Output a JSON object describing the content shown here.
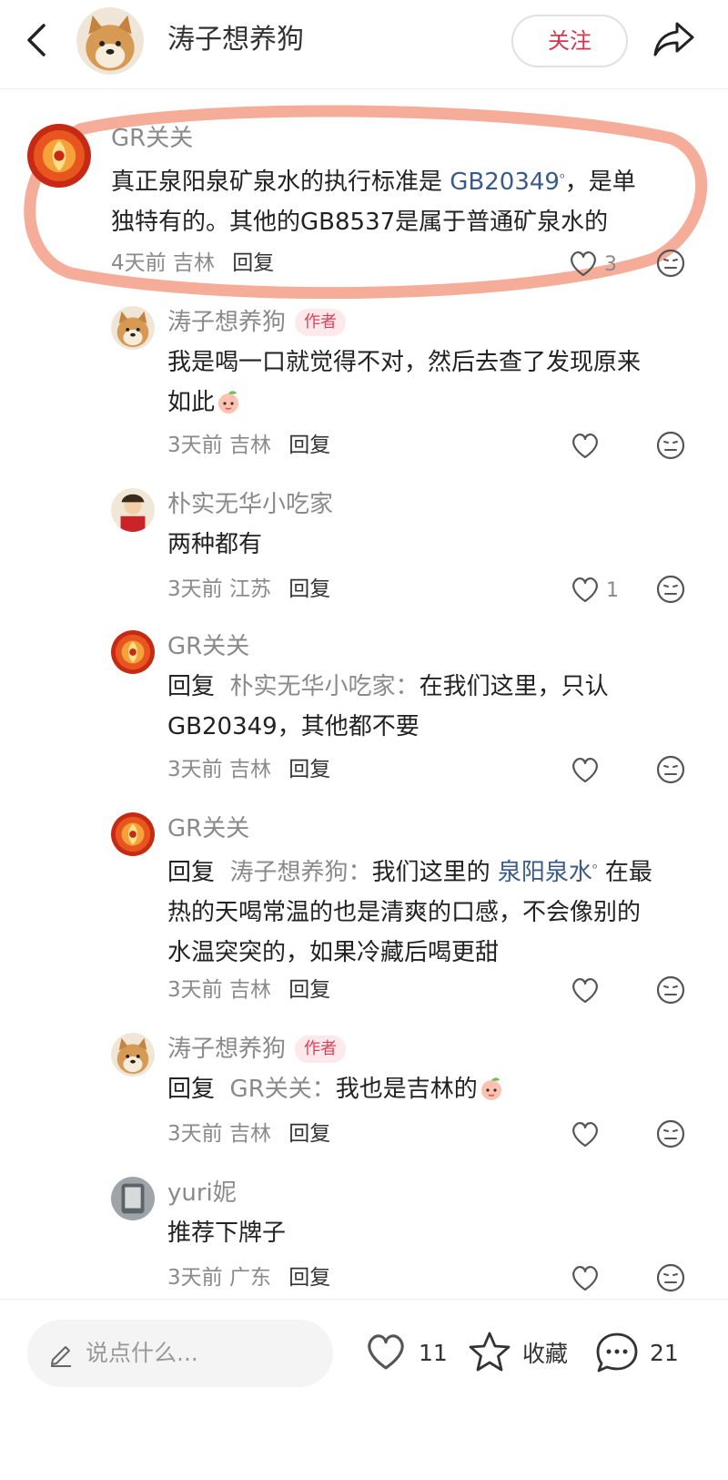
{
  "header": {
    "title": "涛子想养狗",
    "follow_label": "关注"
  },
  "comments": [
    {
      "user": "GR关关",
      "text_line1": "真正泉阳泉矿泉水的执行标准是 ",
      "keyword": "GB20349",
      "text_line1_tail": "，是单",
      "text_line2": "独特有的。其他的GB8537是属于普通矿泉水的",
      "time": "4天前",
      "location": "吉林",
      "reply_label": "回复",
      "likes": "3"
    },
    {
      "user": "涛子想养狗",
      "badge": "作者",
      "text_line1": "我是喝一口就觉得不对，然后去查了发现原来",
      "text_line2": "如此",
      "time": "3天前",
      "location": "吉林",
      "reply_label": "回复",
      "likes": ""
    },
    {
      "user": "朴实无华小吃家",
      "text_line1": "两种都有",
      "time": "3天前",
      "location": "江苏",
      "reply_label": "回复",
      "likes": "1"
    },
    {
      "user": "GR关关",
      "reply_word": "回复",
      "reply_target": "朴实无华小吃家：",
      "text_line1": "在我们这里，只认",
      "text_line2": "GB20349，其他都不要",
      "time": "3天前",
      "location": "吉林",
      "reply_label": "回复",
      "likes": ""
    },
    {
      "user": "GR关关",
      "reply_word": "回复",
      "reply_target": "涛子想养狗：",
      "text_line1_pre": "我们这里的 ",
      "keyword": "泉阳泉水",
      "text_line1_tail": " 在最",
      "text_line2": "热的天喝常温的也是清爽的口感，不会像别的",
      "text_line3": "水温突突的，如果冷藏后喝更甜",
      "time": "3天前",
      "location": "吉林",
      "reply_label": "回复",
      "likes": ""
    },
    {
      "user": "涛子想养狗",
      "badge": "作者",
      "reply_word": "回复",
      "reply_target": "GR关关：",
      "text_line1": "我也是吉林的",
      "time": "3天前",
      "location": "吉林",
      "reply_label": "回复",
      "likes": ""
    },
    {
      "user": "yuri妮",
      "text_line1": "推荐下牌子",
      "time": "3天前",
      "location": "广东",
      "reply_label": "回复",
      "likes": ""
    }
  ],
  "bottom": {
    "input_placeholder": "说点什么...",
    "likes": "11",
    "collect_label": "收藏",
    "comments": "21"
  },
  "colors": {
    "accent": "#d8334a",
    "highlight": "#f4a48e"
  }
}
